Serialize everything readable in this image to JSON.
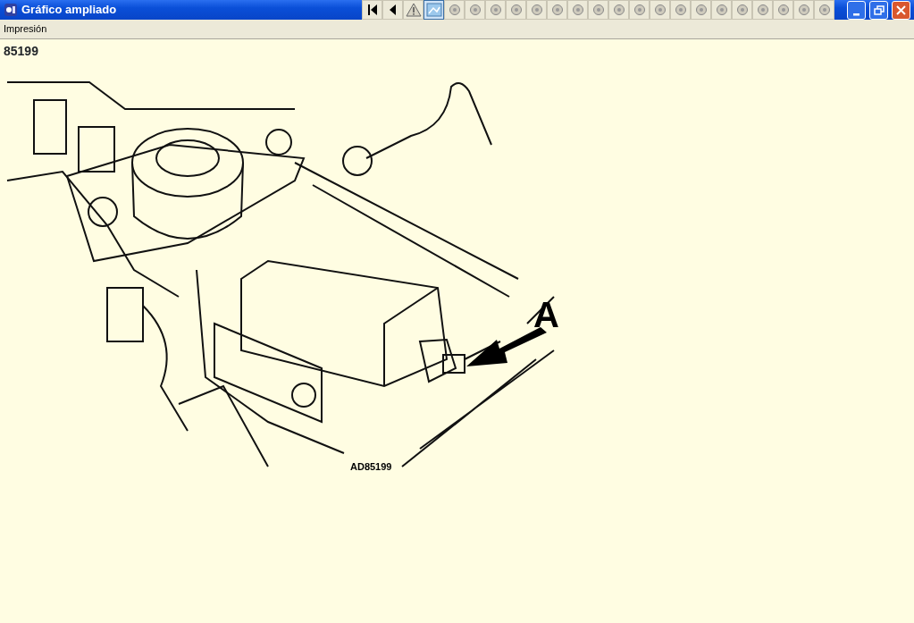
{
  "window": {
    "title": "Gráfico ampliado"
  },
  "toolbar": [
    {
      "kind": "first",
      "selected": false
    },
    {
      "kind": "previous",
      "selected": false
    },
    {
      "kind": "warning",
      "selected": false
    },
    {
      "kind": "image",
      "selected": true
    },
    {
      "kind": "part",
      "selected": false
    },
    {
      "kind": "part",
      "selected": false
    },
    {
      "kind": "part",
      "selected": false
    },
    {
      "kind": "part",
      "selected": false
    },
    {
      "kind": "part",
      "selected": false
    },
    {
      "kind": "part",
      "selected": false
    },
    {
      "kind": "part",
      "selected": false
    },
    {
      "kind": "part",
      "selected": false
    },
    {
      "kind": "part",
      "selected": false
    },
    {
      "kind": "part",
      "selected": false
    },
    {
      "kind": "part",
      "selected": false
    },
    {
      "kind": "part",
      "selected": false
    },
    {
      "kind": "part",
      "selected": false
    },
    {
      "kind": "part",
      "selected": false
    },
    {
      "kind": "part",
      "selected": false
    },
    {
      "kind": "part",
      "selected": false
    },
    {
      "kind": "part",
      "selected": false
    },
    {
      "kind": "part",
      "selected": false
    },
    {
      "kind": "part",
      "selected": false
    }
  ],
  "menu": [
    "Impresión"
  ],
  "figure": {
    "number": "85199",
    "callout": "A",
    "code": "AD85199"
  }
}
